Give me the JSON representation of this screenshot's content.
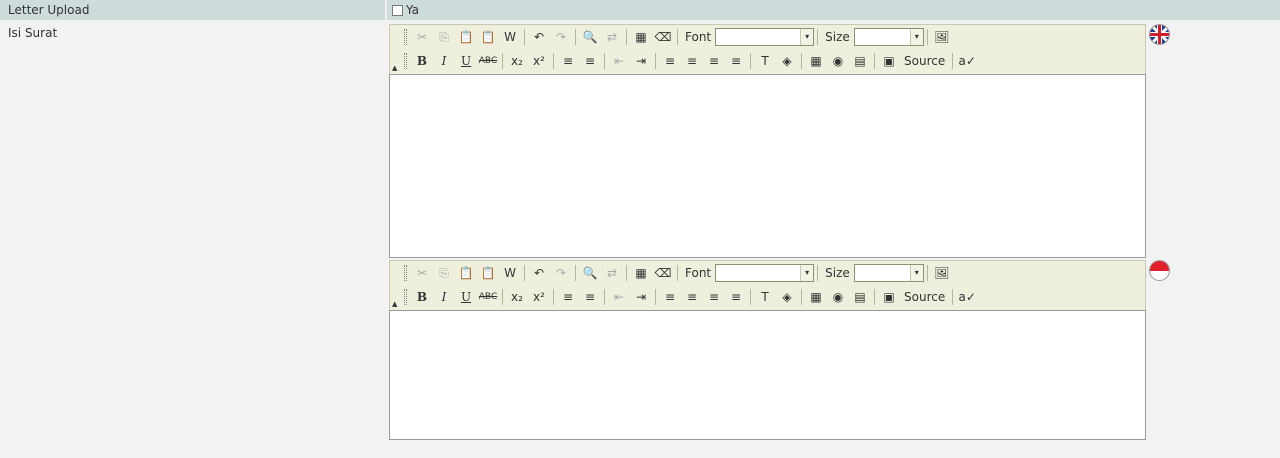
{
  "letter_upload": {
    "label": "Letter Upload",
    "checkbox_label": "Ya",
    "checked": false
  },
  "isi_surat": {
    "label": "Isi Surat"
  },
  "editor": {
    "font_label": "Font",
    "size_label": "Size",
    "source_label": "Source",
    "font_value": "",
    "size_value": ""
  },
  "editors": [
    {
      "language": "English",
      "flag": "uk-flag-icon"
    },
    {
      "language": "Indonesian",
      "flag": "indonesia-flag-icon"
    }
  ],
  "icons": {
    "cut": "✂",
    "copy": "⎘",
    "paste": "📋",
    "paste_text": "📋",
    "paste_word": "W",
    "undo": "↶",
    "redo": "↷",
    "find": "🔍",
    "replace": "⇄",
    "select_all": "▦",
    "remove_format": "⌫",
    "image": "🖼",
    "bold": "B",
    "italic": "I",
    "underline": "U",
    "strike": "ABC",
    "subscript": "x₂",
    "superscript": "x²",
    "ordered_list": "≡",
    "unordered_list": "≡",
    "outdent": "⇤",
    "indent": "⇥",
    "align_left": "≡",
    "align_center": "≡",
    "align_right": "≡",
    "justify": "≡",
    "text_color": "T",
    "bg_color": "◈",
    "table": "▦",
    "flash": "◉",
    "rule": "▤",
    "source": "▣",
    "spell": "a✓",
    "dropdown": "▾"
  }
}
